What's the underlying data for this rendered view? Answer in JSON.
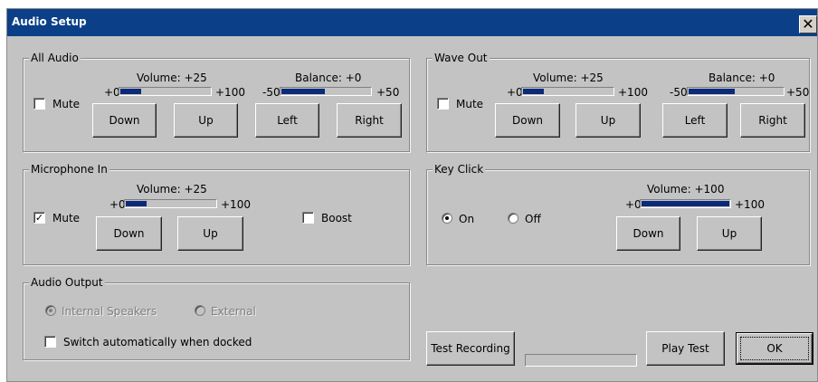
{
  "window": {
    "title": "Audio Setup",
    "close_glyph": "✕"
  },
  "all_audio": {
    "label": "All Audio",
    "mute_label": "Mute",
    "mute_checked": false,
    "volume_label": "Volume: +25",
    "volume_min": "+0",
    "volume_max": "+100",
    "volume_level": 0.25,
    "balance_label": "Balance: +0",
    "balance_min": "-50",
    "balance_max": "+50",
    "balance_level": 0.5,
    "down": "Down",
    "up": "Up",
    "left": "Left",
    "right": "Right"
  },
  "wave_out": {
    "label": "Wave Out",
    "mute_label": "Mute",
    "mute_checked": false,
    "volume_label": "Volume: +25",
    "volume_min": "+0",
    "volume_max": "+100",
    "volume_level": 0.25,
    "balance_label": "Balance: +0",
    "balance_min": "-50",
    "balance_max": "+50",
    "balance_level": 0.5,
    "down": "Down",
    "up": "Up",
    "left": "Left",
    "right": "Right"
  },
  "microphone": {
    "label": "Microphone In",
    "mute_label": "Mute",
    "mute_checked": true,
    "check_glyph": "✓",
    "volume_label": "Volume: +25",
    "volume_min": "+0",
    "volume_max": "+100",
    "volume_level": 0.25,
    "down": "Down",
    "up": "Up",
    "boost_label": "Boost",
    "boost_checked": false
  },
  "key_click": {
    "label": "Key Click",
    "on_label": "On",
    "off_label": "Off",
    "selected": "On",
    "volume_label": "Volume: +100",
    "volume_min": "+0",
    "volume_max": "+100",
    "volume_level": 1.0,
    "down": "Down",
    "up": "Up"
  },
  "audio_output": {
    "label": "Audio Output",
    "internal_label": "Internal Speakers",
    "external_label": "External",
    "selected": "Internal Speakers",
    "disabled": true,
    "switch_label": "Switch automatically when docked",
    "switch_checked": false
  },
  "footer": {
    "test_recording": "Test Recording",
    "recording_progress": 0,
    "play_test": "Play Test",
    "ok": "OK"
  },
  "colors": {
    "titlebar": "#0b3f87",
    "dialog_bg": "#c3c3c3",
    "slider_fill": "#0b2a7a"
  }
}
